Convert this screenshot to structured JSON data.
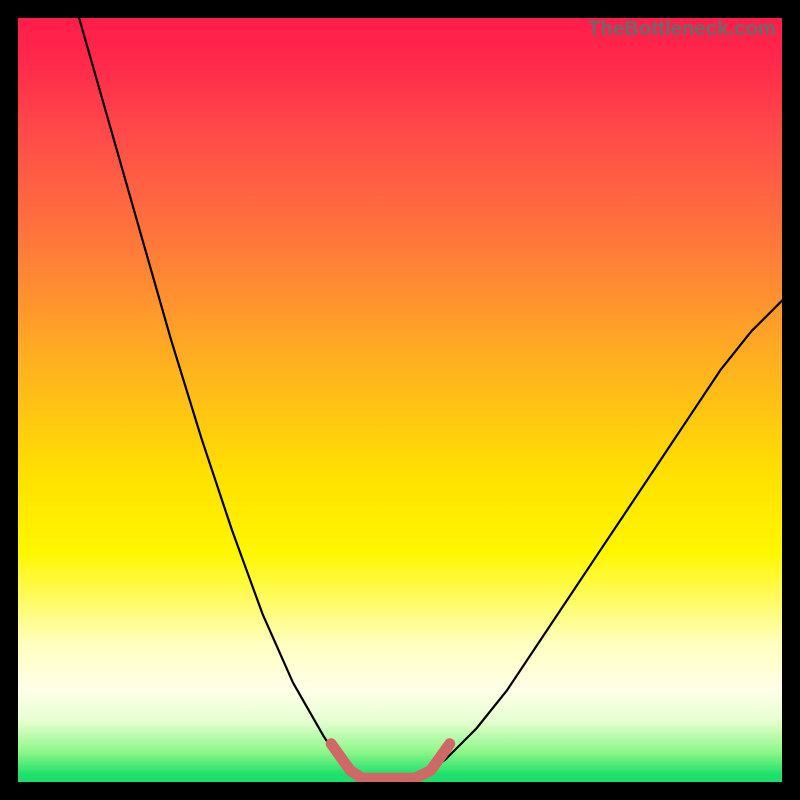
{
  "attribution": "TheBottleneck.com",
  "colors": {
    "frame": "#000000",
    "curve": "#000000",
    "marker": "#d06868",
    "gradient_stops": [
      "#ff1d4a",
      "#ff4a4a",
      "#ff7a3a",
      "#ffb020",
      "#ffe100",
      "#fff700",
      "#ffffc0",
      "#ffffe8",
      "#e6ffd0",
      "#8ff78a",
      "#1fe06a"
    ]
  },
  "chart_data": {
    "type": "line",
    "title": "",
    "xlabel": "",
    "ylabel": "",
    "xlim": [
      0,
      100
    ],
    "ylim": [
      0,
      100
    ],
    "grid": false,
    "legend": false,
    "annotations": [
      "TheBottleneck.com"
    ],
    "series": [
      {
        "name": "left-descending-curve",
        "x": [
          8,
          12,
          16,
          20,
          24,
          28,
          32,
          36,
          40,
          42,
          43.5
        ],
        "y": [
          100,
          86,
          72,
          58,
          45,
          33,
          22,
          13,
          6,
          3,
          1.5
        ]
      },
      {
        "name": "right-ascending-curve",
        "x": [
          54,
          56,
          60,
          64,
          68,
          72,
          76,
          80,
          84,
          88,
          92,
          96,
          100
        ],
        "y": [
          1.5,
          3,
          7,
          12,
          18,
          24,
          30,
          36,
          42,
          48,
          54,
          59,
          63
        ]
      },
      {
        "name": "valley-floor",
        "x": [
          43.5,
          45,
          52,
          54
        ],
        "y": [
          1.5,
          0.5,
          0.5,
          1.5
        ]
      }
    ],
    "marker": {
      "name": "bottom-u-marker",
      "x": [
        41,
        43.5,
        45,
        52,
        54,
        56.5
      ],
      "y": [
        5,
        1.5,
        0.5,
        0.5,
        1.5,
        5
      ],
      "color": "#d06868"
    }
  }
}
